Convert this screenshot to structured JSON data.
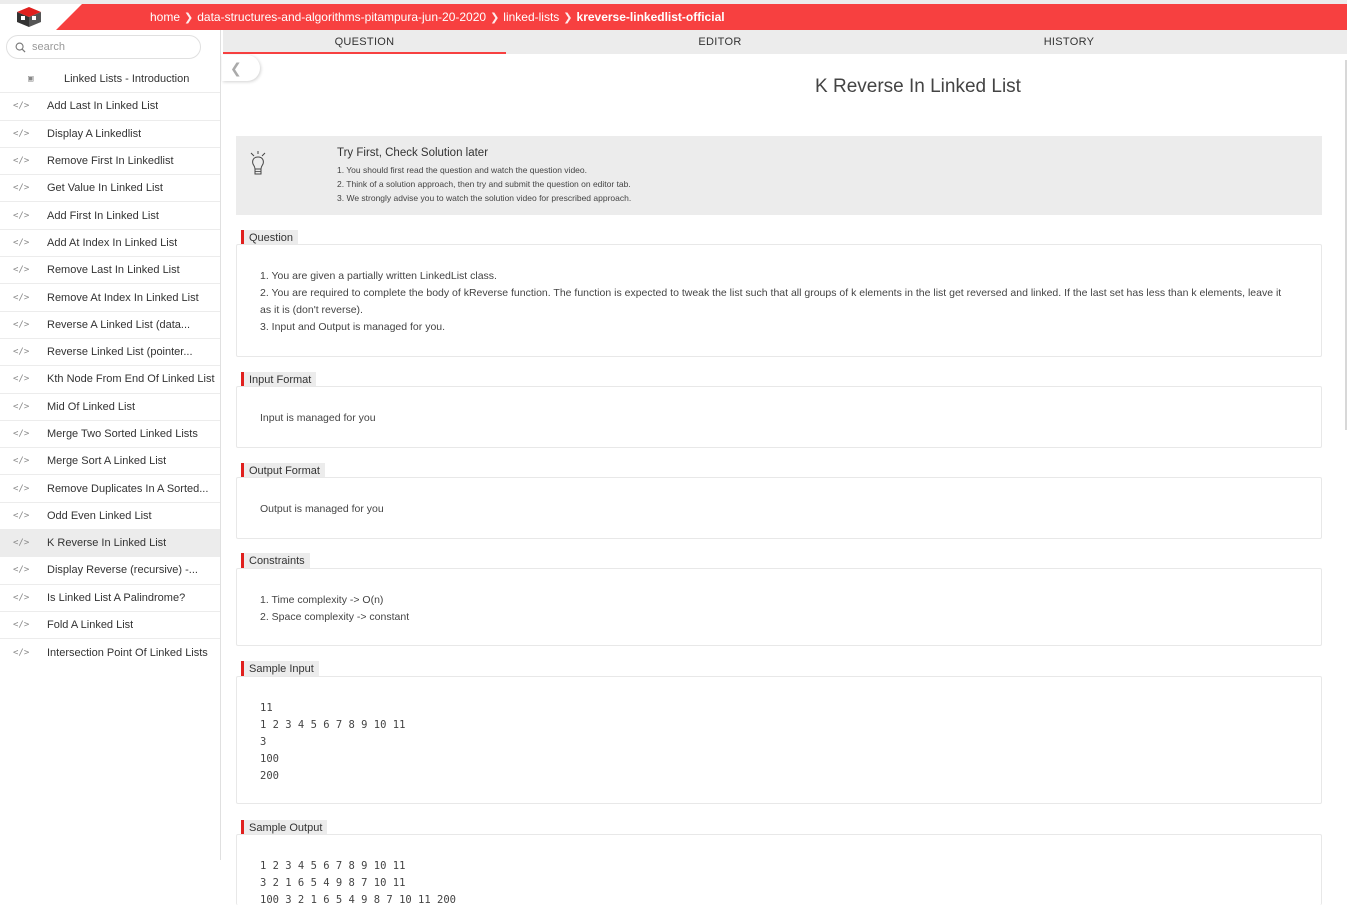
{
  "breadcrumb": {
    "items": [
      "home",
      "data-structures-and-algorithms-pitampura-jun-20-2020",
      "linked-lists"
    ],
    "current": "kreverse-linkedlist-official"
  },
  "search": {
    "placeholder": "search"
  },
  "sidebar": {
    "items": [
      {
        "label": "Linked Lists - Introduction",
        "icon": "video-icon"
      },
      {
        "label": "Add Last In Linked List",
        "icon": "code-icon"
      },
      {
        "label": "Display A Linkedlist",
        "icon": "code-icon"
      },
      {
        "label": "Remove First In Linkedlist",
        "icon": "code-icon"
      },
      {
        "label": "Get Value In Linked List",
        "icon": "code-icon"
      },
      {
        "label": "Add First In Linked List",
        "icon": "code-icon"
      },
      {
        "label": "Add At Index In Linked List",
        "icon": "code-icon"
      },
      {
        "label": "Remove Last In Linked List",
        "icon": "code-icon"
      },
      {
        "label": "Remove At Index In Linked List",
        "icon": "code-icon"
      },
      {
        "label": "Reverse A Linked List (data...",
        "icon": "code-icon"
      },
      {
        "label": "Reverse Linked List (pointer...",
        "icon": "code-icon"
      },
      {
        "label": "Kth Node From End Of Linked List",
        "icon": "code-icon"
      },
      {
        "label": "Mid Of Linked List",
        "icon": "code-icon"
      },
      {
        "label": "Merge Two Sorted Linked Lists",
        "icon": "code-icon"
      },
      {
        "label": "Merge Sort A Linked List",
        "icon": "code-icon"
      },
      {
        "label": "Remove Duplicates In A Sorted...",
        "icon": "code-icon"
      },
      {
        "label": "Odd Even Linked List",
        "icon": "code-icon"
      },
      {
        "label": "K Reverse In Linked List",
        "icon": "code-icon",
        "active": true
      },
      {
        "label": "Display Reverse (recursive) -...",
        "icon": "code-icon"
      },
      {
        "label": "Is Linked List A Palindrome?",
        "icon": "code-icon"
      },
      {
        "label": "Fold A Linked List",
        "icon": "code-icon"
      },
      {
        "label": "Intersection Point Of Linked Lists",
        "icon": "code-icon"
      }
    ]
  },
  "tabs": [
    {
      "label": "QUESTION",
      "active": true
    },
    {
      "label": "EDITOR"
    },
    {
      "label": "HISTORY"
    }
  ],
  "question": {
    "title": "K Reverse In Linked List",
    "tip": {
      "title": "Try First, Check Solution later",
      "lines": [
        "1. You should first read the question and watch the question video.",
        "2. Think of a solution approach, then try and submit the question on editor tab.",
        "3. We strongly advise you to watch the solution video for prescribed approach."
      ]
    },
    "sections": {
      "question": {
        "label": "Question",
        "lines": [
          "1. You are given a partially written LinkedList class.",
          "2. You are required to complete the body of kReverse function. The function is expected to tweak the list such that all groups of k elements in the list get reversed and linked. If the last set has less than k elements, leave it as it is (don't reverse).",
          "3. Input and Output is managed for you."
        ]
      },
      "input_format": {
        "label": "Input Format",
        "text": "Input is managed for you"
      },
      "output_format": {
        "label": "Output Format",
        "text": "Output is managed for you"
      },
      "constraints": {
        "label": "Constraints",
        "lines": [
          "1. Time complexity -> O(n)",
          "2. Space complexity -> constant"
        ]
      },
      "sample_input": {
        "label": "Sample Input",
        "lines": [
          "11",
          "1 2 3 4 5 6 7 8 9 10 11",
          "3",
          "100",
          "200"
        ]
      },
      "sample_output": {
        "label": "Sample Output",
        "lines": [
          "1 2 3 4 5 6 7 8 9 10 11",
          "3 2 1 6 5 4 9 8 7 10 11",
          "100 3 2 1 6 5 4 9 8 7 10 11 200"
        ]
      }
    }
  },
  "colors": {
    "accent": "#f74040",
    "panel": "#ececec"
  }
}
